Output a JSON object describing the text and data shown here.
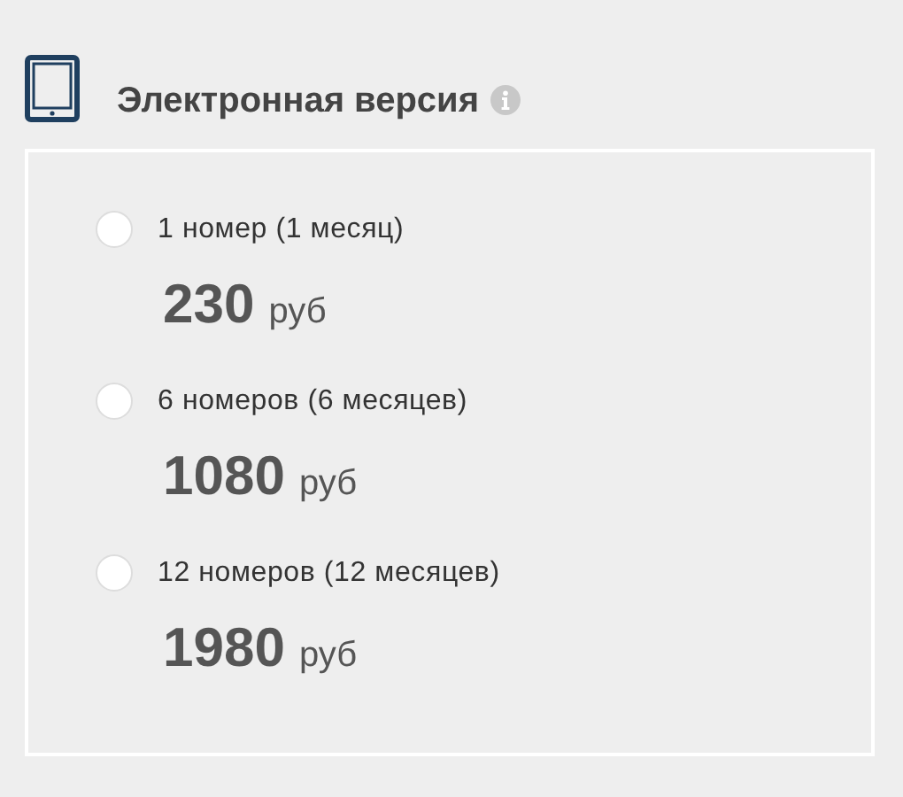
{
  "section": {
    "title": "Электронная версия"
  },
  "options": [
    {
      "label": "1 номер (1 месяц)",
      "price": "230",
      "currency": "руб",
      "selected": false
    },
    {
      "label": "6 номеров (6 месяцев)",
      "price": "1080",
      "currency": "руб",
      "selected": false
    },
    {
      "label": "12 номеров (12 месяцев)",
      "price": "1980",
      "currency": "руб",
      "selected": false
    }
  ]
}
